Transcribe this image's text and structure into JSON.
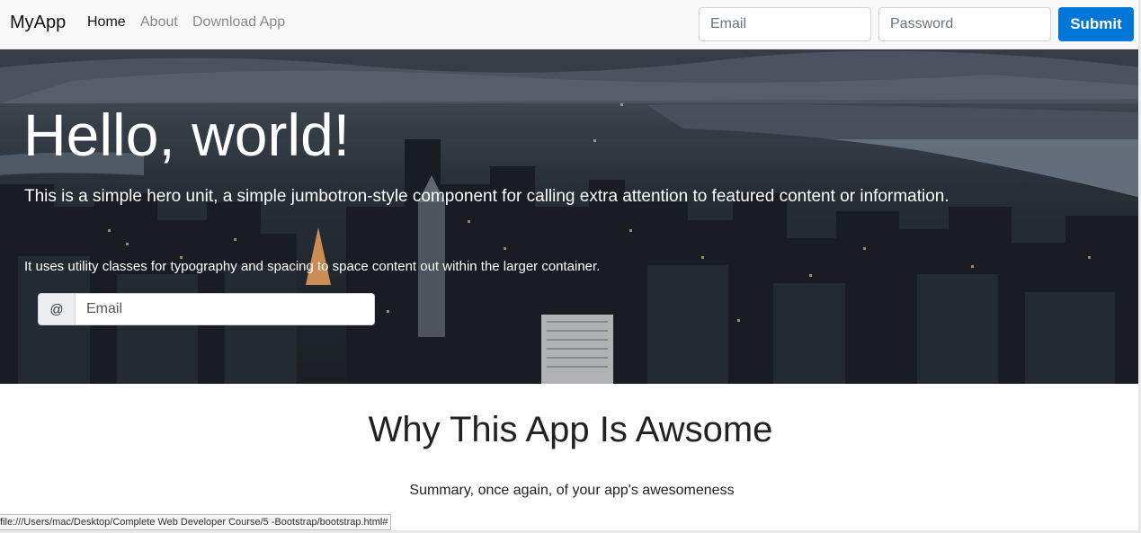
{
  "navbar": {
    "brand": "MyApp",
    "links": [
      {
        "label": "Home",
        "active": true
      },
      {
        "label": "About",
        "active": false
      },
      {
        "label": "Download App",
        "active": false
      }
    ],
    "email_placeholder": "Email",
    "password_placeholder": "Password",
    "submit_label": "Submit"
  },
  "hero": {
    "title": "Hello, world!",
    "lead": "This is a simple hero unit, a simple jumbotron-style component for calling extra attention to featured content or information.",
    "sub": "It uses utility classes for typography and spacing to space content out within the larger container.",
    "addon": "@",
    "email_placeholder": "Email"
  },
  "section": {
    "title": "Why This App Is Awsome",
    "summary": "Summary, once again, of your app's awesomeness"
  },
  "status_bar": {
    "url": "file:///Users/mac/Desktop/Complete Web Developer Course/5 -Bootstrap/bootstrap.html#"
  },
  "colors": {
    "primary": "#0275d8",
    "navbar_bg": "#f8f8f8",
    "hero_text": "#ffffff"
  }
}
